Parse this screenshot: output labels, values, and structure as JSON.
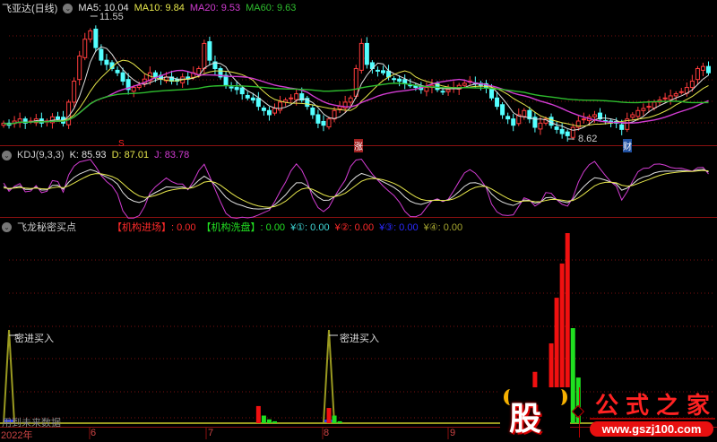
{
  "main_panel": {
    "title": "飞亚达(日线)",
    "ma5": "MA5: 10.04",
    "ma10": "MA10: 9.84",
    "ma20": "MA20: 9.53",
    "ma60": "MA60: 9.63",
    "high_label": "11.55",
    "low_label": "8.62",
    "marker_s": "S",
    "marker_zhang": "涨",
    "marker_cai": "财"
  },
  "kdj_panel": {
    "title": "KDJ(9,3,3)",
    "k": "K: 85.93",
    "d": "D: 87.01",
    "j": "J: 83.78"
  },
  "signal_panel": {
    "title": "飞龙秘密买点",
    "jgjc": "【机构进场】: 0.00",
    "jgxp": "【机构洗盘】: 0.00",
    "y1": "¥①: 0.00",
    "y2": "¥②: 0.00",
    "y3": "¥③: 0.00",
    "y4": "¥④: 0.00",
    "annotation": "密进买入",
    "watermark": "用到未来数据"
  },
  "x_axis": [
    "2022年",
    "6",
    "7",
    "8",
    "9"
  ],
  "colors": {
    "up": "#ff3c3c",
    "down": "#54ffff",
    "ma5": "#e0e0e0",
    "ma10": "#e6e64b",
    "ma20": "#d23cd2",
    "ma60": "#2ebd2e",
    "grid": "#7a1010"
  },
  "logo": {
    "char": "股",
    "name": "公式之家",
    "url": "www.gszj100.com"
  },
  "chart_data": {
    "type": "candlestick",
    "closes": [
      9.0,
      8.95,
      9.05,
      9.1,
      9.0,
      9.05,
      9.1,
      9.0,
      9.05,
      9.15,
      9.1,
      9.0,
      9.5,
      10.0,
      10.6,
      11.0,
      11.2,
      10.8,
      10.5,
      10.4,
      10.3,
      10.2,
      10.0,
      9.8,
      9.85,
      9.9,
      10.05,
      10.2,
      10.1,
      10.05,
      10.1,
      10.0,
      10.0,
      10.1,
      10.05,
      10.2,
      10.3,
      10.9,
      10.5,
      10.3,
      10.1,
      9.9,
      9.85,
      9.8,
      9.7,
      9.6,
      9.55,
      9.4,
      9.3,
      9.2,
      9.35,
      9.5,
      9.55,
      9.6,
      9.7,
      9.55,
      9.4,
      9.2,
      9.0,
      8.95,
      9.1,
      9.3,
      9.4,
      9.5,
      9.6,
      10.3,
      10.9,
      10.4,
      10.3,
      10.25,
      10.2,
      10.1,
      10.05,
      10.0,
      9.95,
      9.9,
      9.85,
      9.8,
      9.85,
      9.9,
      9.8,
      9.75,
      9.8,
      9.85,
      9.9,
      9.95,
      10.0,
      9.95,
      9.9,
      9.85,
      9.6,
      9.4,
      9.2,
      9.1,
      8.95,
      9.2,
      9.3,
      9.1,
      8.9,
      9.0,
      9.1,
      8.95,
      8.85,
      8.75,
      8.7,
      8.9,
      9.05,
      9.1,
      9.15,
      9.2,
      9.1,
      9.05,
      9.0,
      9.0,
      8.85,
      9.1,
      9.2,
      9.3,
      9.35,
      9.4,
      9.5,
      9.55,
      9.6,
      9.65,
      9.7,
      9.75,
      9.85,
      10.0,
      10.3,
      10.35,
      10.2
    ],
    "price_range": [
      8.3,
      11.9
    ],
    "signal_bars": [
      {
        "index": 47,
        "value": 9,
        "color": "red"
      },
      {
        "index": 48,
        "value": 4,
        "color": "green"
      },
      {
        "index": 49,
        "value": 2,
        "color": "green"
      },
      {
        "index": 50,
        "value": 1,
        "color": "green"
      },
      {
        "index": 60,
        "value": 8,
        "color": "red"
      },
      {
        "index": 61,
        "value": 4,
        "color": "green"
      },
      {
        "index": 62,
        "value": 1,
        "color": "green"
      },
      {
        "index": 98,
        "value": 27,
        "color": "red"
      },
      {
        "index": 101,
        "value": 42,
        "color": "red"
      },
      {
        "index": 102,
        "value": 66,
        "color": "red"
      },
      {
        "index": 103,
        "value": 84,
        "color": "red"
      },
      {
        "index": 104,
        "value": 100,
        "color": "red"
      },
      {
        "index": 105,
        "value": 50,
        "color": "green"
      },
      {
        "index": 106,
        "value": 24,
        "color": "green"
      }
    ],
    "buy_signal_indices": [
      1,
      60
    ]
  }
}
